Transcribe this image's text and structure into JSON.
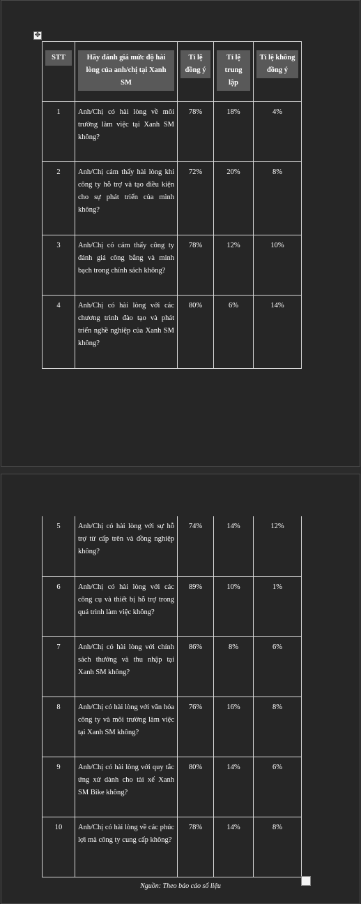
{
  "table": {
    "headers": {
      "stt": "STT",
      "question": "Hãy đánh giá mức độ hài lòng của anh/chị tại Xanh SM",
      "agree": "Tỉ lệ đồng ý",
      "neutral": "Tỉ lệ trung lập",
      "disagree": "Tỉ lệ không đồng ý"
    },
    "rows": [
      {
        "stt": "1",
        "question": "Anh/Chị có hài lòng về môi trường làm việc tại Xanh SM không?",
        "agree": "78%",
        "neutral": "18%",
        "disagree": "4%"
      },
      {
        "stt": "2",
        "question": "Anh/Chị cảm thấy hài lòng khi công ty hỗ trợ và tạo điều kiện cho sự phát triển của mình không?",
        "agree": "72%",
        "neutral": "20%",
        "disagree": "8%"
      },
      {
        "stt": "3",
        "question": "Anh/Chị có cảm thấy công ty đánh giá công bằng và minh bạch trong chính sách không?",
        "agree": "78%",
        "neutral": "12%",
        "disagree": "10%"
      },
      {
        "stt": "4",
        "question": "Anh/Chị có hài lòng với các chương trình đào tạo và phát triển nghề nghiệp của Xanh SM không?",
        "agree": "80%",
        "neutral": "6%",
        "disagree": "14%"
      },
      {
        "stt": "5",
        "question": "Anh/Chị có hài lòng với sự hỗ trợ từ cấp trên và đồng nghiệp không?",
        "agree": "74%",
        "neutral": "14%",
        "disagree": "12%"
      },
      {
        "stt": "6",
        "question": "Anh/Chị có hài lòng với các công cụ và thiết bị hỗ trợ trong quá trình làm việc không?",
        "agree": "89%",
        "neutral": "10%",
        "disagree": "1%"
      },
      {
        "stt": "7",
        "question": "Anh/Chị có hài lòng với chính sách thưởng và thu nhập tại Xanh SM không?",
        "agree": "86%",
        "neutral": "8%",
        "disagree": "6%"
      },
      {
        "stt": "8",
        "question": "Anh/Chị có hài lòng với văn hóa công ty và môi trường làm việc tại Xanh SM không?",
        "agree": "76%",
        "neutral": "16%",
        "disagree": "8%"
      },
      {
        "stt": "9",
        "question": "Anh/Chị có hài lòng với quy tắc ứng xử dành cho tài xế Xanh SM Bike không?",
        "agree": "80%",
        "neutral": "14%",
        "disagree": "6%"
      },
      {
        "stt": "10",
        "question": "Anh/Chị có hài lòng về các phúc lợi mà công ty cung cấp không?",
        "agree": "78%",
        "neutral": "14%",
        "disagree": "8%"
      }
    ]
  },
  "source_note": "Nguồn: Theo báo cáo số liệu",
  "icons": {
    "table_move_handle": "move-arrows-icon",
    "end_of_cell_mark": "paragraph-end-marker"
  },
  "colors": {
    "page_background": "#262626",
    "header_fill": "#595959",
    "text": "#ffffff"
  }
}
